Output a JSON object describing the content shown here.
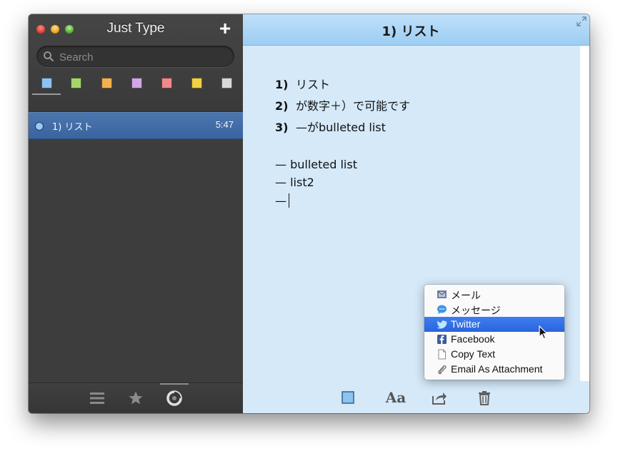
{
  "app": {
    "title": "Just Type",
    "add_label": "+"
  },
  "search": {
    "placeholder": "Search"
  },
  "color_filters": [
    {
      "name": "blue",
      "color": "#8cc3f3"
    },
    {
      "name": "green",
      "color": "#a6d66a"
    },
    {
      "name": "orange",
      "color": "#f2b24f"
    },
    {
      "name": "purple",
      "color": "#d4a6e6"
    },
    {
      "name": "red",
      "color": "#f0898a"
    },
    {
      "name": "yellow",
      "color": "#f1d145"
    },
    {
      "name": "gray",
      "color": "#d8d8d8"
    }
  ],
  "notes": [
    {
      "title": "1)  リスト",
      "time": "5:47",
      "selected": true
    }
  ],
  "sidebar_toolbar": {
    "icons": [
      "list-icon",
      "star-icon",
      "recent-icon"
    ],
    "active": "recent-icon"
  },
  "editor": {
    "title": "1)  リスト",
    "numbered": [
      {
        "num": "1)",
        "text": "リスト"
      },
      {
        "num": "2)",
        "text": "が数字＋）で可能です"
      },
      {
        "num": "3)",
        "text": "—がbulleted list"
      }
    ],
    "bullets": [
      "— bulleted list",
      "— list2",
      "—"
    ]
  },
  "editor_toolbar": {
    "font_label": "Aa",
    "icons": [
      "color-square-icon",
      "font-icon",
      "share-icon",
      "trash-icon"
    ]
  },
  "share_menu": {
    "items": [
      {
        "label": "メール",
        "icon": "mail-icon",
        "highlighted": false
      },
      {
        "label": "メッセージ",
        "icon": "messages-icon",
        "highlighted": false
      },
      {
        "label": "Twitter",
        "icon": "twitter-icon",
        "highlighted": true
      },
      {
        "label": "Facebook",
        "icon": "facebook-icon",
        "highlighted": false
      },
      {
        "label": "Copy Text",
        "icon": "document-icon",
        "highlighted": false
      },
      {
        "label": "Email As Attachment",
        "icon": "paperclip-icon",
        "highlighted": false
      }
    ]
  },
  "colors": {
    "sidebar_bg": "#3d3d3d",
    "selection_blue": "#3a64a0",
    "editor_bg": "#d5e9f9",
    "menu_highlight": "#2a64dd"
  }
}
